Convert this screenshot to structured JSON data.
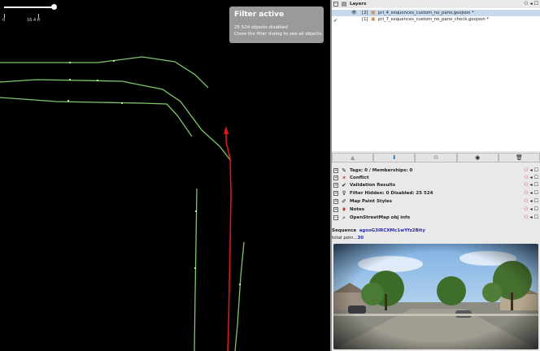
{
  "map": {
    "scale": {
      "zero_label": "0",
      "distance_label": "16.4 ft"
    },
    "filter_popup": {
      "title": "Filter active",
      "count_text": "25 524 objects disabled",
      "hint_text": "Close the filter dialog to see all objects."
    }
  },
  "colors": {
    "map_bg": "#000000",
    "track_green": "#7ec86a",
    "track_red": "#e01818",
    "link_blue": "#2a2aa8"
  },
  "layers_panel": {
    "title": "Layers",
    "layers": [
      {
        "index": "[2]",
        "name": "pri_4_sequences_custom_no_pano.geojson *",
        "selected": true
      },
      {
        "index": "[1]",
        "name": "pri_7_sequences_custom_no_pano_check.geojson *",
        "selected": false
      }
    ],
    "toolbar_icons": [
      "move-up-icon",
      "move-down-icon",
      "merge-icon",
      "visibility-icon",
      "delete-icon"
    ]
  },
  "dialogs": [
    {
      "icon": "tags-icon",
      "label": "Tags: 0 / Memberships: 0"
    },
    {
      "icon": "conflict-icon",
      "label": "Conflict"
    },
    {
      "icon": "check-icon",
      "label": "Validation Results"
    },
    {
      "icon": "filter-icon",
      "label": "Filter Hidden: 0 Disabled: 25 524"
    },
    {
      "icon": "paint-icon",
      "label": "Map Paint Styles"
    },
    {
      "icon": "pin-icon",
      "label": "Notes"
    },
    {
      "icon": "magnifier-icon",
      "label": "OpenStreetMap obj info"
    }
  ],
  "sequence": {
    "label": "Sequence",
    "id": "agxoG3IRCXMc1wYfz2Bity",
    "total_label": "total poin...",
    "total_value": "30"
  }
}
